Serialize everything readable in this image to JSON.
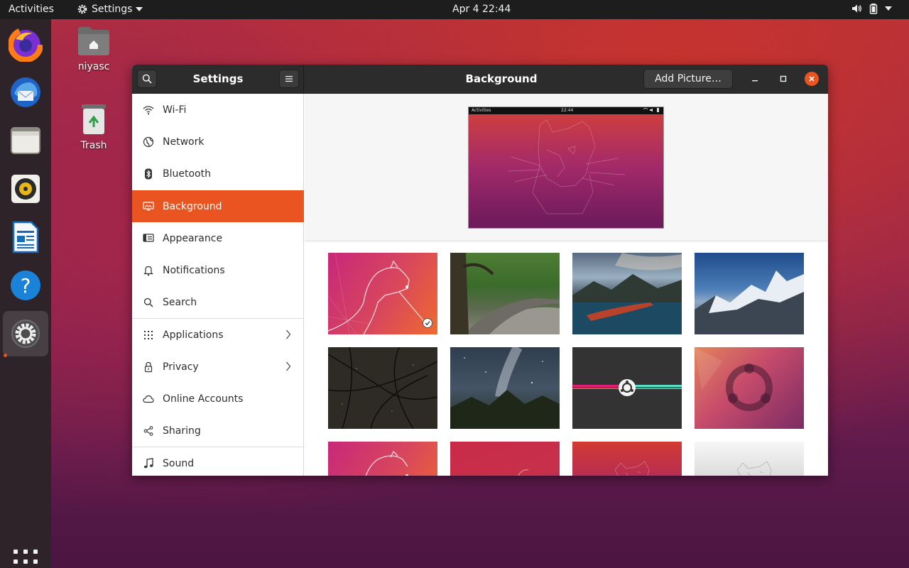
{
  "topbar": {
    "activities": "Activities",
    "app_menu": "Settings",
    "clock": "Apr 4  22:44"
  },
  "dock": {
    "items": [
      "firefox-icon",
      "thunderbird-icon",
      "files-icon",
      "rhythmbox-icon",
      "libreoffice-writer-icon",
      "help-icon",
      "settings-icon"
    ],
    "active": "settings-icon"
  },
  "desktop": {
    "home_label": "niyasc",
    "trash_label": "Trash"
  },
  "window": {
    "sidebar_title": "Settings",
    "page_title": "Background",
    "add_picture": "Add Picture…"
  },
  "sidebar": {
    "items": [
      {
        "label": "Wi-Fi",
        "icon": "wifi-icon"
      },
      {
        "label": "Network",
        "icon": "network-icon"
      },
      {
        "label": "Bluetooth",
        "icon": "bluetooth-icon"
      },
      {
        "label": "Background",
        "icon": "background-icon",
        "selected": true
      },
      {
        "label": "Appearance",
        "icon": "appearance-icon"
      },
      {
        "label": "Notifications",
        "icon": "bell-icon"
      },
      {
        "label": "Search",
        "icon": "search-icon"
      },
      {
        "label": "Applications",
        "icon": "apps-grid-icon",
        "has_arrow": true
      },
      {
        "label": "Privacy",
        "icon": "lock-icon",
        "has_arrow": true
      },
      {
        "label": "Online Accounts",
        "icon": "cloud-icon"
      },
      {
        "label": "Sharing",
        "icon": "share-icon"
      },
      {
        "label": "Sound",
        "icon": "music-note-icon"
      }
    ]
  },
  "preview": {
    "mini_activities": "Activities",
    "mini_clock": "22:44"
  },
  "wallpapers": [
    {
      "name": "focal-fossa-orange-wallpaper",
      "selected": true
    },
    {
      "name": "stone-wall-path-wallpaper"
    },
    {
      "name": "lake-boat-mountains-wallpaper"
    },
    {
      "name": "snowy-mountains-wallpaper"
    },
    {
      "name": "dark-branches-wallpaper"
    },
    {
      "name": "milky-way-mountains-wallpaper"
    },
    {
      "name": "ubuntu-logo-stripes-wallpaper"
    },
    {
      "name": "ubuntu-logo-abstract-wallpaper"
    },
    {
      "name": "focal-fossa-orange-2-wallpaper"
    },
    {
      "name": "pink-red-gradient-wallpaper"
    },
    {
      "name": "focal-fossa-purple-wallpaper"
    },
    {
      "name": "focal-fossa-grey-wallpaper"
    }
  ],
  "colors": {
    "accent": "#e95420",
    "headerbar": "#2c2c2c",
    "topbar": "#1d1d1d",
    "dock": "#2d2329"
  }
}
